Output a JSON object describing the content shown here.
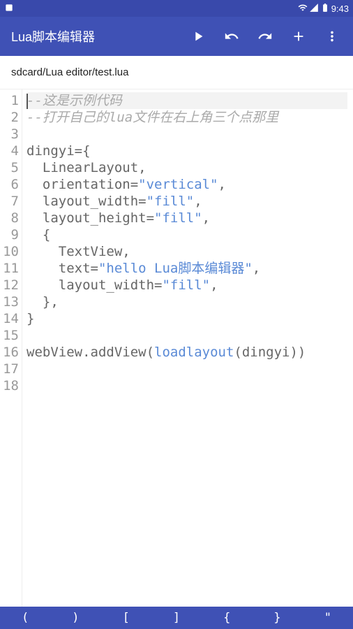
{
  "statusBar": {
    "time": "9:43"
  },
  "appBar": {
    "title": "Lua脚本编辑器"
  },
  "breadcrumb": "sdcard/Lua editor/test.lua",
  "code": {
    "totalLines": 18,
    "lines": [
      {
        "n": 1,
        "segs": [
          {
            "t": "--这是示例代码",
            "cls": "c-comment"
          }
        ],
        "bg": "line1",
        "cursorBefore": true
      },
      {
        "n": 2,
        "segs": [
          {
            "t": "--打开自己的lua文件在右上角三个点那里",
            "cls": "c-comment"
          }
        ]
      },
      {
        "n": 3,
        "segs": []
      },
      {
        "n": 4,
        "segs": [
          {
            "t": "dingyi={",
            "cls": "c-text"
          }
        ]
      },
      {
        "n": 5,
        "segs": [
          {
            "t": "  LinearLayout,",
            "cls": "c-text"
          }
        ]
      },
      {
        "n": 6,
        "segs": [
          {
            "t": "  orientation=",
            "cls": "c-text"
          },
          {
            "t": "\"vertical\"",
            "cls": "c-string"
          },
          {
            "t": ",",
            "cls": "c-text"
          }
        ]
      },
      {
        "n": 7,
        "segs": [
          {
            "t": "  layout_width=",
            "cls": "c-text"
          },
          {
            "t": "\"fill\"",
            "cls": "c-string"
          },
          {
            "t": ",",
            "cls": "c-text"
          }
        ]
      },
      {
        "n": 8,
        "segs": [
          {
            "t": "  layout_height=",
            "cls": "c-text"
          },
          {
            "t": "\"fill\"",
            "cls": "c-string"
          },
          {
            "t": ",",
            "cls": "c-text"
          }
        ]
      },
      {
        "n": 9,
        "segs": [
          {
            "t": "  {",
            "cls": "c-text"
          }
        ]
      },
      {
        "n": 10,
        "segs": [
          {
            "t": "    TextView,",
            "cls": "c-text"
          }
        ]
      },
      {
        "n": 11,
        "segs": [
          {
            "t": "    text=",
            "cls": "c-text"
          },
          {
            "t": "\"hello Lua脚本编辑器\"",
            "cls": "c-string"
          },
          {
            "t": ",",
            "cls": "c-text"
          }
        ]
      },
      {
        "n": 12,
        "segs": [
          {
            "t": "    layout_width=",
            "cls": "c-text"
          },
          {
            "t": "\"fill\"",
            "cls": "c-string"
          },
          {
            "t": ",",
            "cls": "c-text"
          }
        ]
      },
      {
        "n": 13,
        "segs": [
          {
            "t": "  },",
            "cls": "c-text"
          }
        ]
      },
      {
        "n": 14,
        "segs": [
          {
            "t": "}",
            "cls": "c-text"
          }
        ]
      },
      {
        "n": 15,
        "segs": []
      },
      {
        "n": 16,
        "segs": [
          {
            "t": "webView.addView(",
            "cls": "c-text"
          },
          {
            "t": "loadlayout",
            "cls": "c-func"
          },
          {
            "t": "(dingyi))",
            "cls": "c-text"
          }
        ]
      },
      {
        "n": 17,
        "segs": []
      },
      {
        "n": 18,
        "segs": []
      }
    ]
  },
  "bottomBar": {
    "keys": [
      "(",
      ")",
      "[",
      "]",
      "{",
      "}",
      "\""
    ]
  }
}
